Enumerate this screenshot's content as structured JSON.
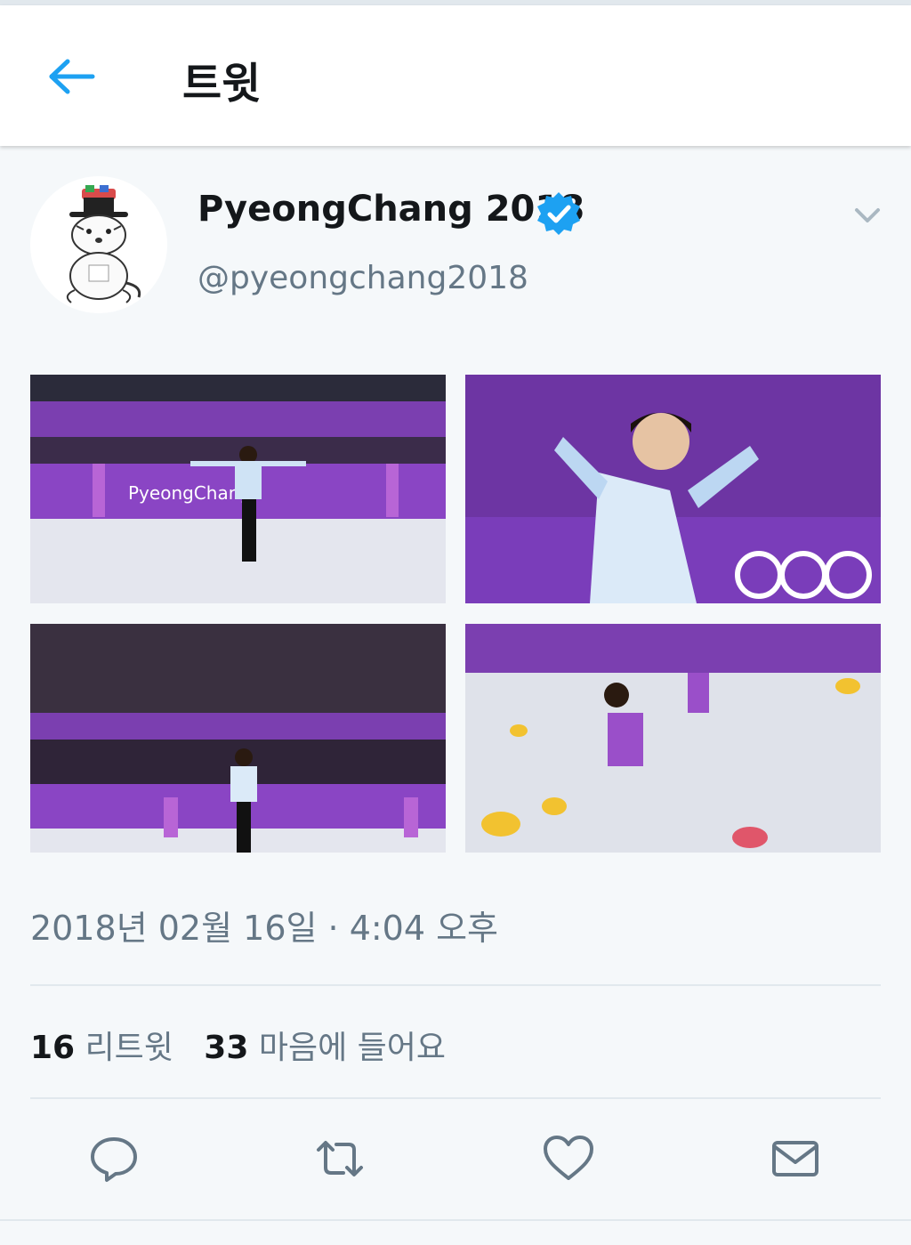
{
  "header": {
    "title": "트윗",
    "back_icon": "arrow-left-icon"
  },
  "tweet": {
    "author": {
      "display_name": "PyeongChang 2018",
      "handle": "@pyeongchang2018",
      "verified": true,
      "avatar_icon": "mascot-tiger-avatar"
    },
    "media": [
      {
        "alt_icon": "figure-skating-photo"
      },
      {
        "alt_icon": "figure-skating-photo"
      },
      {
        "alt_icon": "figure-skating-photo"
      },
      {
        "alt_icon": "figure-skating-photo"
      }
    ],
    "timestamp": "2018년 02월 16일 · 4:04 오후",
    "stats": {
      "retweets_count": "16",
      "retweets_label": "리트윗",
      "likes_count": "33",
      "likes_label": "마음에 들어요"
    },
    "actions": [
      {
        "icon": "reply-icon"
      },
      {
        "icon": "retweet-icon"
      },
      {
        "icon": "heart-icon"
      },
      {
        "icon": "mail-icon"
      }
    ]
  },
  "colors": {
    "accent": "#1da1f2",
    "verified": "#1da1f2",
    "secondary_text": "#657786",
    "arena_purple": "#7b3fb0",
    "ice": "#e6e8f0"
  }
}
